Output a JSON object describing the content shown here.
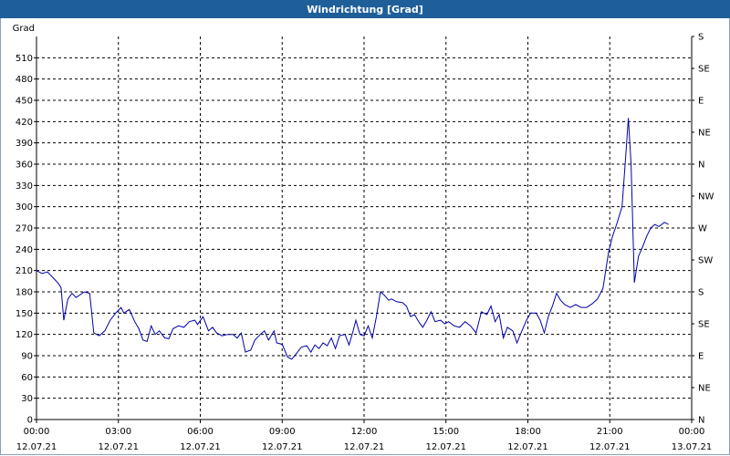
{
  "window": {
    "title": "Windrichtung [Grad]"
  },
  "chart_data": {
    "type": "line",
    "title": "Windrichtung [Grad]",
    "ylabel": "Grad",
    "ylim": [
      0,
      540
    ],
    "yticks": [
      0,
      30,
      60,
      90,
      120,
      150,
      180,
      210,
      240,
      270,
      300,
      330,
      360,
      390,
      420,
      450,
      480,
      510
    ],
    "y2_labels": [
      {
        "value": 0,
        "label": "N"
      },
      {
        "value": 45,
        "label": "NE"
      },
      {
        "value": 90,
        "label": "E"
      },
      {
        "value": 135,
        "label": "SE"
      },
      {
        "value": 180,
        "label": "S"
      },
      {
        "value": 225,
        "label": "SW"
      },
      {
        "value": 270,
        "label": "W"
      },
      {
        "value": 315,
        "label": "NW"
      },
      {
        "value": 360,
        "label": "N"
      },
      {
        "value": 405,
        "label": "NE"
      },
      {
        "value": 450,
        "label": "E"
      },
      {
        "value": 495,
        "label": "SE"
      },
      {
        "value": 540,
        "label": "S"
      }
    ],
    "xlim": [
      0,
      24
    ],
    "xticks": [
      {
        "hour": 0,
        "time": "00:00",
        "date": "12.07.21"
      },
      {
        "hour": 3,
        "time": "03:00",
        "date": "12.07.21"
      },
      {
        "hour": 6,
        "time": "06:00",
        "date": "12.07.21"
      },
      {
        "hour": 9,
        "time": "09:00",
        "date": "12.07.21"
      },
      {
        "hour": 12,
        "time": "12:00",
        "date": "12.07.21"
      },
      {
        "hour": 15,
        "time": "15:00",
        "date": "12.07.21"
      },
      {
        "hour": 18,
        "time": "18:00",
        "date": "12.07.21"
      },
      {
        "hour": 21,
        "time": "21:00",
        "date": "12.07.21"
      },
      {
        "hour": 24,
        "time": "00:00",
        "date": "13.07.21"
      }
    ],
    "grid": true,
    "series": [
      {
        "color": "#0000aa",
        "points": [
          [
            0.0,
            210
          ],
          [
            0.2,
            206
          ],
          [
            0.4,
            208
          ],
          [
            0.6,
            200
          ],
          [
            0.8,
            192
          ],
          [
            0.9,
            186
          ],
          [
            1.0,
            140
          ],
          [
            1.15,
            170
          ],
          [
            1.3,
            178
          ],
          [
            1.45,
            172
          ],
          [
            1.6,
            176
          ],
          [
            1.75,
            180
          ],
          [
            1.95,
            178
          ],
          [
            2.1,
            122
          ],
          [
            2.3,
            118
          ],
          [
            2.5,
            125
          ],
          [
            2.7,
            140
          ],
          [
            2.9,
            150
          ],
          [
            3.1,
            158
          ],
          [
            3.2,
            150
          ],
          [
            3.4,
            155
          ],
          [
            3.6,
            138
          ],
          [
            3.75,
            128
          ],
          [
            3.9,
            112
          ],
          [
            4.05,
            110
          ],
          [
            4.2,
            132
          ],
          [
            4.35,
            120
          ],
          [
            4.5,
            125
          ],
          [
            4.7,
            115
          ],
          [
            4.85,
            114
          ],
          [
            5.0,
            128
          ],
          [
            5.2,
            132
          ],
          [
            5.4,
            130
          ],
          [
            5.6,
            138
          ],
          [
            5.8,
            140
          ],
          [
            5.9,
            134
          ],
          [
            6.1,
            145
          ],
          [
            6.3,
            125
          ],
          [
            6.45,
            130
          ],
          [
            6.6,
            122
          ],
          [
            6.8,
            118
          ],
          [
            7.0,
            120
          ],
          [
            7.2,
            120
          ],
          [
            7.35,
            115
          ],
          [
            7.5,
            122
          ],
          [
            7.65,
            95
          ],
          [
            7.85,
            98
          ],
          [
            8.0,
            112
          ],
          [
            8.2,
            120
          ],
          [
            8.35,
            125
          ],
          [
            8.5,
            112
          ],
          [
            8.7,
            125
          ],
          [
            8.8,
            108
          ],
          [
            9.0,
            106
          ],
          [
            9.2,
            88
          ],
          [
            9.35,
            85
          ],
          [
            9.5,
            92
          ],
          [
            9.7,
            102
          ],
          [
            9.9,
            104
          ],
          [
            10.05,
            95
          ],
          [
            10.2,
            105
          ],
          [
            10.35,
            100
          ],
          [
            10.5,
            108
          ],
          [
            10.65,
            104
          ],
          [
            10.8,
            115
          ],
          [
            10.95,
            100
          ],
          [
            11.1,
            118
          ],
          [
            11.3,
            120
          ],
          [
            11.45,
            105
          ],
          [
            11.6,
            125
          ],
          [
            11.7,
            140
          ],
          [
            11.85,
            120
          ],
          [
            12.0,
            118
          ],
          [
            12.15,
            132
          ],
          [
            12.3,
            115
          ],
          [
            12.45,
            145
          ],
          [
            12.6,
            180
          ],
          [
            12.75,
            175
          ],
          [
            12.9,
            168
          ],
          [
            13.0,
            170
          ],
          [
            13.2,
            166
          ],
          [
            13.4,
            165
          ],
          [
            13.55,
            160
          ],
          [
            13.7,
            145
          ],
          [
            13.85,
            148
          ],
          [
            14.0,
            138
          ],
          [
            14.15,
            130
          ],
          [
            14.3,
            140
          ],
          [
            14.45,
            152
          ],
          [
            14.6,
            138
          ],
          [
            14.8,
            140
          ],
          [
            14.95,
            135
          ],
          [
            15.1,
            138
          ],
          [
            15.3,
            132
          ],
          [
            15.5,
            130
          ],
          [
            15.7,
            138
          ],
          [
            15.9,
            132
          ],
          [
            16.1,
            122
          ],
          [
            16.3,
            152
          ],
          [
            16.5,
            148
          ],
          [
            16.65,
            160
          ],
          [
            16.8,
            138
          ],
          [
            16.95,
            148
          ],
          [
            17.1,
            115
          ],
          [
            17.25,
            130
          ],
          [
            17.45,
            125
          ],
          [
            17.6,
            108
          ],
          [
            17.75,
            122
          ],
          [
            17.95,
            140
          ],
          [
            18.1,
            150
          ],
          [
            18.3,
            150
          ],
          [
            18.45,
            140
          ],
          [
            18.6,
            122
          ],
          [
            18.75,
            145
          ],
          [
            18.9,
            160
          ],
          [
            19.05,
            178
          ],
          [
            19.2,
            168
          ],
          [
            19.35,
            162
          ],
          [
            19.55,
            158
          ],
          [
            19.75,
            162
          ],
          [
            19.95,
            158
          ],
          [
            20.15,
            158
          ],
          [
            20.35,
            163
          ],
          [
            20.55,
            170
          ],
          [
            20.75,
            185
          ],
          [
            20.95,
            235
          ],
          [
            21.1,
            258
          ],
          [
            21.25,
            275
          ],
          [
            21.45,
            300
          ],
          [
            21.6,
            380
          ],
          [
            21.68,
            425
          ],
          [
            21.78,
            360
          ],
          [
            21.9,
            193
          ],
          [
            22.05,
            230
          ],
          [
            22.2,
            243
          ],
          [
            22.35,
            258
          ],
          [
            22.5,
            270
          ],
          [
            22.65,
            275
          ],
          [
            22.8,
            272
          ],
          [
            23.0,
            278
          ],
          [
            23.15,
            275
          ]
        ]
      }
    ]
  }
}
